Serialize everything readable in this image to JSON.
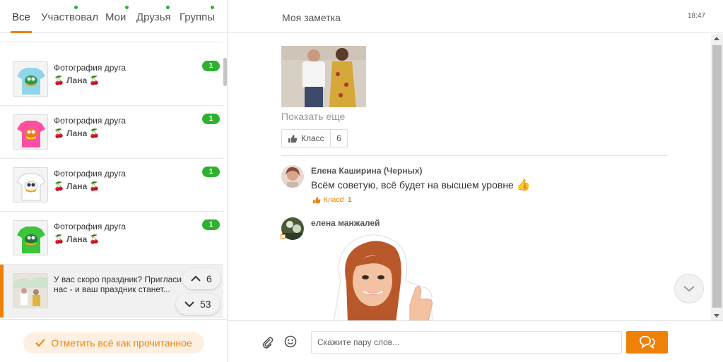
{
  "tabs": [
    {
      "label": "Все",
      "active": true,
      "dot": false
    },
    {
      "label": "Участвовал",
      "active": false,
      "dot": true
    },
    {
      "label": "Мои",
      "active": false,
      "dot": true
    },
    {
      "label": "Друзья",
      "active": false,
      "dot": true
    },
    {
      "label": "Группы",
      "active": false,
      "dot": true
    }
  ],
  "list": {
    "items": [
      {
        "title": "Фотография друга",
        "author": "Лана",
        "badge": "1",
        "shirt_color": "#8fd6e8"
      },
      {
        "title": "Фотография друга",
        "author": "Лана",
        "badge": "1",
        "shirt_color": "#ff4fa3"
      },
      {
        "title": "Фотография друга",
        "author": "Лана",
        "badge": "1",
        "shirt_color": "#ffffff"
      },
      {
        "title": "Фотография друга",
        "author": "Лана",
        "badge": "1",
        "shirt_color": "#3cc43c"
      }
    ],
    "selected": {
      "line1": "У вас скоро праздник? Пригласи",
      "line2": "нас - и ваш праздник станет..."
    },
    "nav_up_count": "6",
    "nav_down_count": "53",
    "mark_all_label": "Отметить всё как прочитанное"
  },
  "chat": {
    "title": "Моя заметка",
    "time": "18:47",
    "show_more": "Показать еще",
    "klass_label": "Класс",
    "klass_count": "6",
    "messages": [
      {
        "author": "Елена Каширина (Черных)",
        "text": "Всём советую, всё будет на высшем уровне",
        "like_label": "Класс!",
        "like_count": "1"
      },
      {
        "author": "елена манжалей"
      }
    ],
    "input_placeholder": "Скажите пару слов..."
  },
  "colors": {
    "accent": "#ee8208",
    "badge": "#2fb12f"
  }
}
